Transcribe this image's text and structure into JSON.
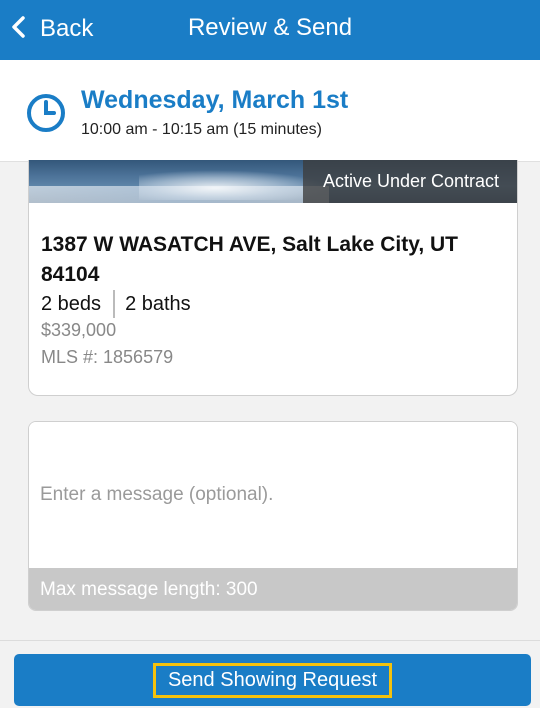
{
  "header": {
    "back_label": "Back",
    "title": "Review & Send"
  },
  "appointment": {
    "date": "Wednesday, March 1st",
    "time": "10:00 am - 10:15 am (15 minutes)"
  },
  "listing": {
    "status": "Active Under Contract",
    "address": "1387 W WASATCH AVE, Salt Lake City, UT 84104",
    "beds": "2 beds",
    "baths": "2 baths",
    "price": "$339,000",
    "mls": "MLS #: 1856579"
  },
  "message": {
    "placeholder": "Enter a message (optional).",
    "max_length_note": "Max message length: 300"
  },
  "actions": {
    "send_label": "Send Showing Request"
  },
  "colors": {
    "brand_blue": "#1a7dc6",
    "highlight": "#f4c20d"
  }
}
